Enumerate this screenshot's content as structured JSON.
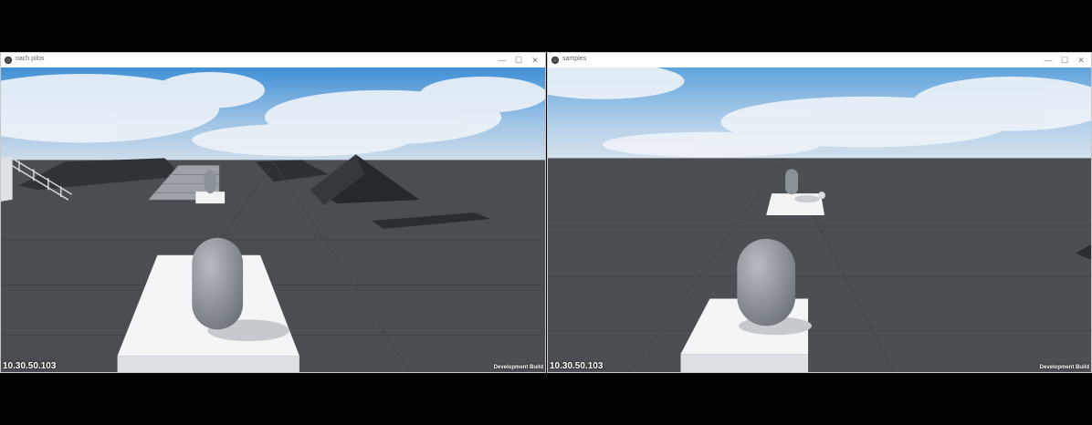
{
  "windows": [
    {
      "title": "oach pilos",
      "controls": {
        "minimize": "—",
        "maximize": "☐",
        "close": "✕"
      },
      "overlay": {
        "ip": "10.30.50.103",
        "build": "Development Build"
      }
    },
    {
      "title": "samples",
      "controls": {
        "minimize": "—",
        "maximize": "☐",
        "close": "✕"
      },
      "overlay": {
        "ip": "10.30.50.103",
        "build": "Development Build"
      }
    }
  ],
  "colors": {
    "sky_top": "#3f8fd6",
    "sky_horizon": "#cfdcea",
    "ground": "#4a4d52",
    "platform": "#f4f5f7",
    "capsule": "#8c9299"
  }
}
